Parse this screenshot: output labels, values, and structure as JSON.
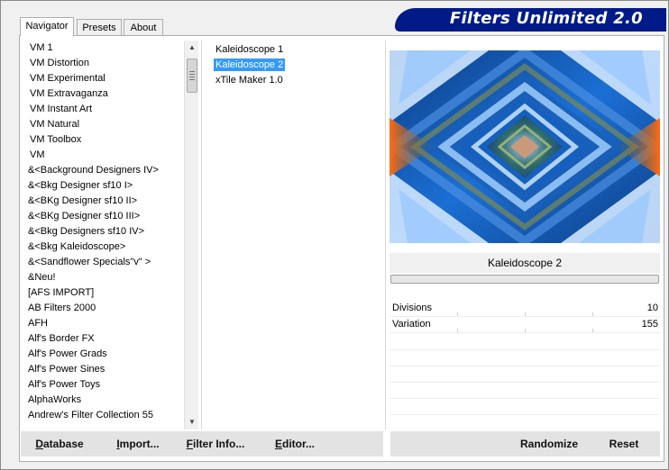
{
  "title": "Filters Unlimited 2.0",
  "tabs": [
    {
      "label": "Navigator",
      "active": true
    },
    {
      "label": "Presets",
      "active": false
    },
    {
      "label": "About",
      "active": false
    }
  ],
  "categories": [
    "VM 1",
    "VM Distortion",
    "VM Experimental",
    "VM Extravaganza",
    "VM Instant Art",
    "VM Natural",
    "VM Toolbox",
    "VM",
    "&<Background Designers IV>",
    "&<Bkg Designer sf10 I>",
    "&<BKg Designer sf10 II>",
    "&<BKg Designer sf10 III>",
    "&<Bkg Designers sf10 IV>",
    "&<Bkg Kaleidoscope>",
    "&<Sandflower Specials\"v\" >",
    "&Neu!",
    "[AFS IMPORT]",
    "AB Filters 2000",
    "AFH",
    "Alf's Border FX",
    "Alf's Power Grads",
    "Alf's Power Sines",
    "Alf's Power Toys",
    "AlphaWorks",
    "Andrew's Filter Collection 55"
  ],
  "filters": [
    {
      "label": "Kaleidoscope 1",
      "selected": false
    },
    {
      "label": "Kaleidoscope 2",
      "selected": true
    },
    {
      "label": "xTile Maker 1.0",
      "selected": false
    }
  ],
  "preview": {
    "filter_name": "Kaleidoscope 2"
  },
  "params": [
    {
      "name": "Divisions",
      "value": "10"
    },
    {
      "name": "Variation",
      "value": "155"
    }
  ],
  "buttons": {
    "database": {
      "first": "D",
      "rest": "atabase"
    },
    "import": {
      "first": "I",
      "rest": "mport..."
    },
    "filter_info": {
      "first": "F",
      "rest": "ilter Info..."
    },
    "editor": {
      "first": "E",
      "rest": "ditor..."
    },
    "randomize": "Randomize",
    "reset": "Reset"
  },
  "colors": {
    "banner": "#001a88",
    "selection": "#3399ff"
  }
}
